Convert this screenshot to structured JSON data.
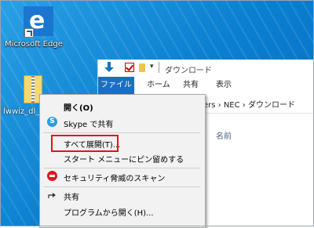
{
  "desktop": {
    "edge_label": "Microsoft Edge",
    "zip_label": "lwwiz_dl_"
  },
  "explorer": {
    "title": "ダウンロード",
    "tabs": [
      "ファイル",
      "ホーム",
      "共有",
      "表示"
    ],
    "address": "ers › NEC › ダウンロード",
    "column_header": "名前"
  },
  "context_menu": {
    "open": "開く(O)",
    "skype_share": "Skype で共有",
    "extract_all": "すべて展開(T)...",
    "pin_start": "スタート メニューにピン留めする",
    "security_scan": "セキュリティ脅威のスキャン",
    "share": "共有",
    "open_with": "プログラムから開く(H)..."
  },
  "colors": {
    "highlight": "#e2151b",
    "file_tab": "#1a6fc4"
  }
}
